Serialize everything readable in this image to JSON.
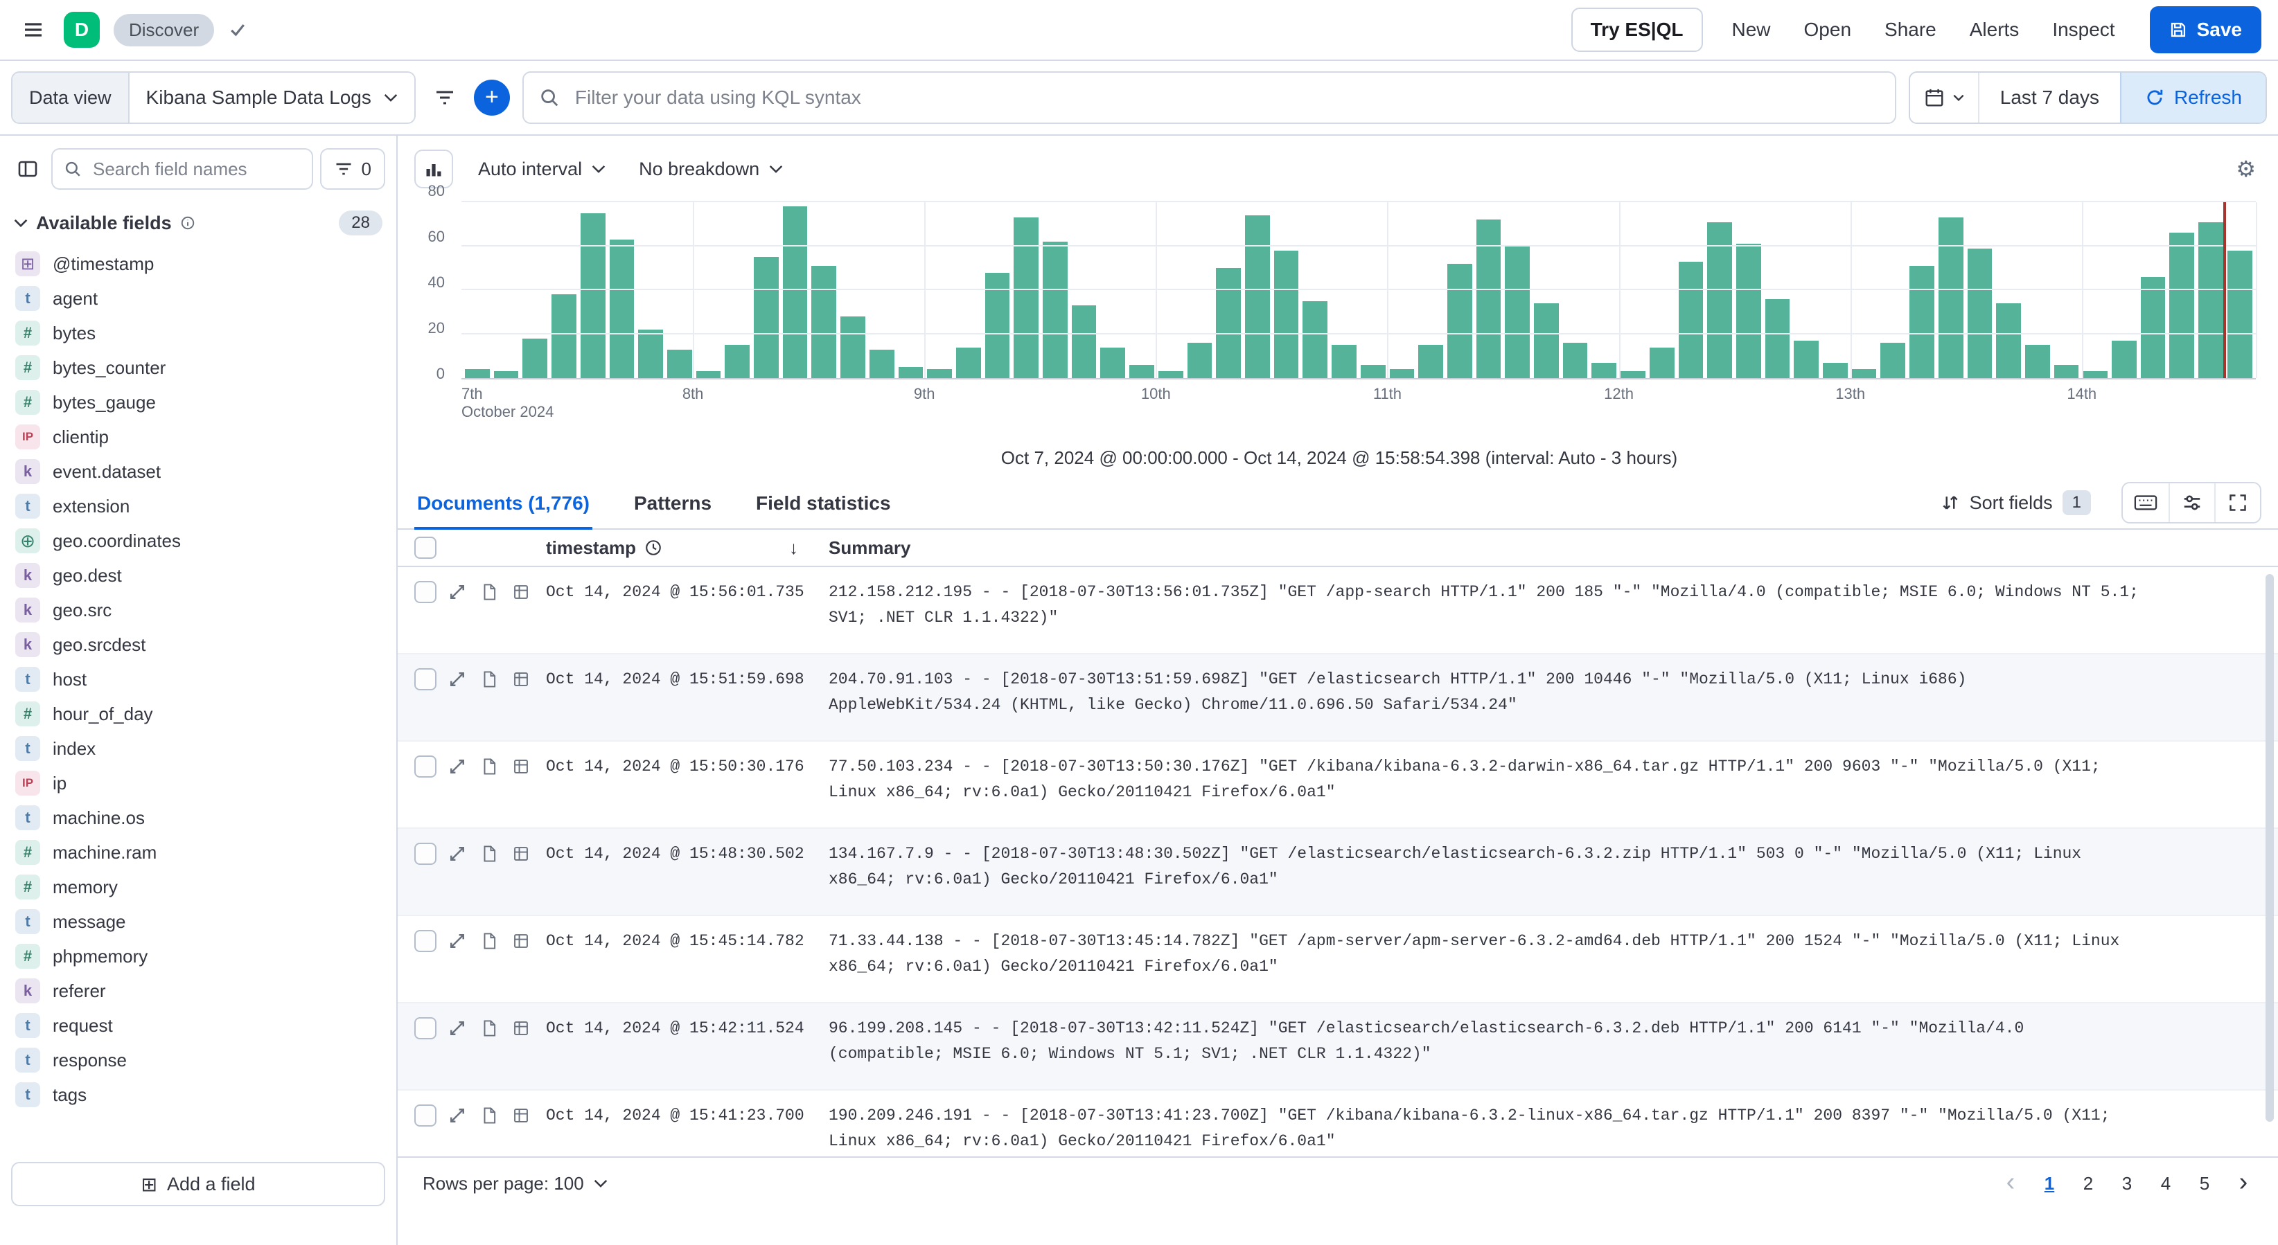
{
  "colors": {
    "primary": "#0b64dd",
    "avatar_green": "#00bd79",
    "border": "#d3dae6",
    "zebra_row": "#f5f7fa"
  },
  "header": {
    "logo_letter": "D",
    "breadcrumb": "Discover",
    "try_esql_label": "Try ES|QL",
    "actions": [
      "New",
      "Open",
      "Share",
      "Alerts",
      "Inspect"
    ],
    "save_label": "Save"
  },
  "query_bar": {
    "data_view_label": "Data view",
    "data_view_value": "Kibana Sample Data Logs",
    "search_placeholder": "Filter your data using KQL syntax",
    "time_range_label": "Last 7 days",
    "refresh_label": "Refresh"
  },
  "sidebar": {
    "search_placeholder": "Search field names",
    "filter_count": "0",
    "section_label": "Available fields",
    "section_count": "28",
    "add_field_label": "Add a field",
    "add_field_icon": "⊞",
    "fields": [
      {
        "name": "@timestamp",
        "type": "date",
        "glyph": "⊞"
      },
      {
        "name": "agent",
        "type": "text",
        "glyph": "t"
      },
      {
        "name": "bytes",
        "type": "number",
        "glyph": "#"
      },
      {
        "name": "bytes_counter",
        "type": "number",
        "glyph": "#"
      },
      {
        "name": "bytes_gauge",
        "type": "number",
        "glyph": "#"
      },
      {
        "name": "clientip",
        "type": "ip",
        "glyph": "IP"
      },
      {
        "name": "event.dataset",
        "type": "keyword",
        "glyph": "k"
      },
      {
        "name": "extension",
        "type": "text",
        "glyph": "t"
      },
      {
        "name": "geo.coordinates",
        "type": "geo",
        "glyph": "⊕"
      },
      {
        "name": "geo.dest",
        "type": "keyword",
        "glyph": "k"
      },
      {
        "name": "geo.src",
        "type": "keyword",
        "glyph": "k"
      },
      {
        "name": "geo.srcdest",
        "type": "keyword",
        "glyph": "k"
      },
      {
        "name": "host",
        "type": "text",
        "glyph": "t"
      },
      {
        "name": "hour_of_day",
        "type": "number",
        "glyph": "#"
      },
      {
        "name": "index",
        "type": "text",
        "glyph": "t"
      },
      {
        "name": "ip",
        "type": "ip",
        "glyph": "IP"
      },
      {
        "name": "machine.os",
        "type": "text",
        "glyph": "t"
      },
      {
        "name": "machine.ram",
        "type": "number",
        "glyph": "#"
      },
      {
        "name": "memory",
        "type": "number",
        "glyph": "#"
      },
      {
        "name": "message",
        "type": "text",
        "glyph": "t"
      },
      {
        "name": "phpmemory",
        "type": "number",
        "glyph": "#"
      },
      {
        "name": "referer",
        "type": "keyword",
        "glyph": "k"
      },
      {
        "name": "request",
        "type": "text",
        "glyph": "t"
      },
      {
        "name": "response",
        "type": "text",
        "glyph": "t"
      },
      {
        "name": "tags",
        "type": "text",
        "glyph": "t"
      }
    ]
  },
  "histogram": {
    "interval_label": "Auto interval",
    "breakdown_label": "No breakdown",
    "caption": "Oct 7, 2024 @ 00:00:00.000 - Oct 14, 2024 @ 15:58:54.398 (interval: Auto - 3 hours)"
  },
  "chart_data": {
    "type": "bar",
    "bar_color": "#54b399",
    "marker_color": "#a7342d",
    "ylim": [
      0,
      80
    ],
    "yticks": [
      0,
      20,
      40,
      60,
      80
    ],
    "x_ticks": [
      {
        "label": "7th",
        "pos": 0
      },
      {
        "label": "8th",
        "pos": 12.9
      },
      {
        "label": "9th",
        "pos": 25.8
      },
      {
        "label": "10th",
        "pos": 38.7
      },
      {
        "label": "11th",
        "pos": 51.6
      },
      {
        "label": "12th",
        "pos": 64.5
      },
      {
        "label": "13th",
        "pos": 77.4
      },
      {
        "label": "14th",
        "pos": 90.3
      }
    ],
    "x_axis_secondary": "October 2024",
    "now_marker_pos": 98.2,
    "values": [
      4,
      3,
      18,
      38,
      75,
      63,
      22,
      13,
      3,
      15,
      55,
      78,
      51,
      28,
      13,
      5,
      4,
      14,
      48,
      73,
      62,
      33,
      14,
      6,
      3,
      16,
      50,
      74,
      58,
      35,
      15,
      6,
      4,
      15,
      52,
      72,
      60,
      34,
      16,
      7,
      3,
      14,
      53,
      71,
      61,
      36,
      17,
      7,
      4,
      16,
      51,
      73,
      59,
      34,
      15,
      6,
      3,
      17,
      46,
      66,
      71,
      58
    ]
  },
  "documents": {
    "tabs": [
      {
        "label": "Documents (1,776)",
        "state": "active"
      },
      {
        "label": "Patterns",
        "state": "normal"
      },
      {
        "label": "Field statistics",
        "state": "normal"
      }
    ],
    "sort_fields_label": "Sort fields",
    "sort_fields_count": "1",
    "columns": {
      "timestamp": "timestamp",
      "summary": "Summary"
    },
    "sort_indicator": "↓",
    "rows": [
      {
        "timestamp": "Oct 14, 2024 @ 15:56:01.735",
        "summary": "212.158.212.195 - - [2018-07-30T13:56:01.735Z] \"GET /app-search HTTP/1.1\" 200 185 \"-\" \"Mozilla/4.0 (compatible; MSIE 6.0; Windows NT 5.1; SV1; .NET CLR 1.1.4322)\""
      },
      {
        "timestamp": "Oct 14, 2024 @ 15:51:59.698",
        "summary": "204.70.91.103 - - [2018-07-30T13:51:59.698Z] \"GET /elasticsearch HTTP/1.1\" 200 10446 \"-\" \"Mozilla/5.0 (X11; Linux i686) AppleWebKit/534.24 (KHTML, like Gecko) Chrome/11.0.696.50 Safari/534.24\""
      },
      {
        "timestamp": "Oct 14, 2024 @ 15:50:30.176",
        "summary": "77.50.103.234 - - [2018-07-30T13:50:30.176Z] \"GET /kibana/kibana-6.3.2-darwin-x86_64.tar.gz HTTP/1.1\" 200 9603 \"-\" \"Mozilla/5.0 (X11; Linux x86_64; rv:6.0a1) Gecko/20110421 Firefox/6.0a1\""
      },
      {
        "timestamp": "Oct 14, 2024 @ 15:48:30.502",
        "summary": "134.167.7.9 - - [2018-07-30T13:48:30.502Z] \"GET /elasticsearch/elasticsearch-6.3.2.zip HTTP/1.1\" 503 0 \"-\" \"Mozilla/5.0 (X11; Linux x86_64; rv:6.0a1) Gecko/20110421 Firefox/6.0a1\""
      },
      {
        "timestamp": "Oct 14, 2024 @ 15:45:14.782",
        "summary": "71.33.44.138 - - [2018-07-30T13:45:14.782Z] \"GET /apm-server/apm-server-6.3.2-amd64.deb HTTP/1.1\" 200 1524 \"-\" \"Mozilla/5.0 (X11; Linux x86_64; rv:6.0a1) Gecko/20110421 Firefox/6.0a1\""
      },
      {
        "timestamp": "Oct 14, 2024 @ 15:42:11.524",
        "summary": "96.199.208.145 - - [2018-07-30T13:42:11.524Z] \"GET /elasticsearch/elasticsearch-6.3.2.deb HTTP/1.1\" 200 6141 \"-\" \"Mozilla/4.0 (compatible; MSIE 6.0; Windows NT 5.1; SV1; .NET CLR 1.1.4322)\""
      },
      {
        "timestamp": "Oct 14, 2024 @ 15:41:23.700",
        "summary": "190.209.246.191 - - [2018-07-30T13:41:23.700Z] \"GET /kibana/kibana-6.3.2-linux-x86_64.tar.gz HTTP/1.1\" 200 8397 \"-\" \"Mozilla/5.0 (X11; Linux x86_64; rv:6.0a1) Gecko/20110421 Firefox/6.0a1\""
      }
    ],
    "rows_per_page_label": "Rows per page: 100",
    "pagination": [
      {
        "n": "1",
        "state": "active"
      },
      {
        "n": "2",
        "state": "normal"
      },
      {
        "n": "3",
        "state": "normal"
      },
      {
        "n": "4",
        "state": "normal"
      },
      {
        "n": "5",
        "state": "normal"
      }
    ],
    "prev_label": "‹",
    "next_label": "›"
  }
}
